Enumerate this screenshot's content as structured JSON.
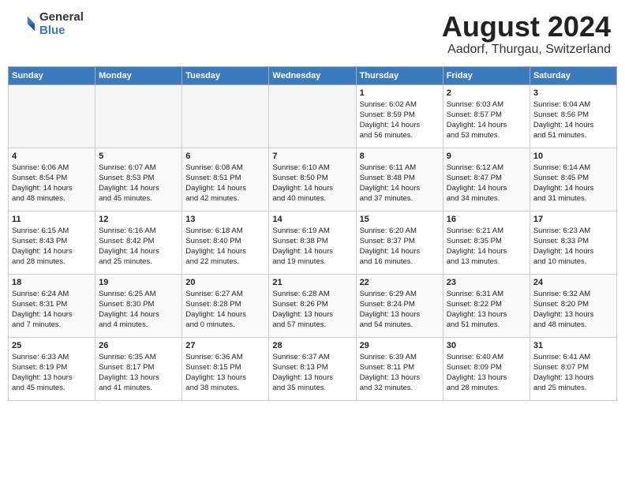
{
  "header": {
    "logo_general": "General",
    "logo_blue": "Blue",
    "month_title": "August 2024",
    "location": "Aadorf, Thurgau, Switzerland"
  },
  "days_of_week": [
    "Sunday",
    "Monday",
    "Tuesday",
    "Wednesday",
    "Thursday",
    "Friday",
    "Saturday"
  ],
  "weeks": [
    [
      {
        "day": "",
        "info": ""
      },
      {
        "day": "",
        "info": ""
      },
      {
        "day": "",
        "info": ""
      },
      {
        "day": "",
        "info": ""
      },
      {
        "day": "1",
        "info": "Sunrise: 6:02 AM\nSunset: 8:59 PM\nDaylight: 14 hours\nand 56 minutes."
      },
      {
        "day": "2",
        "info": "Sunrise: 6:03 AM\nSunset: 8:57 PM\nDaylight: 14 hours\nand 53 minutes."
      },
      {
        "day": "3",
        "info": "Sunrise: 6:04 AM\nSunset: 8:56 PM\nDaylight: 14 hours\nand 51 minutes."
      }
    ],
    [
      {
        "day": "4",
        "info": "Sunrise: 6:06 AM\nSunset: 8:54 PM\nDaylight: 14 hours\nand 48 minutes."
      },
      {
        "day": "5",
        "info": "Sunrise: 6:07 AM\nSunset: 8:53 PM\nDaylight: 14 hours\nand 45 minutes."
      },
      {
        "day": "6",
        "info": "Sunrise: 6:08 AM\nSunset: 8:51 PM\nDaylight: 14 hours\nand 42 minutes."
      },
      {
        "day": "7",
        "info": "Sunrise: 6:10 AM\nSunset: 8:50 PM\nDaylight: 14 hours\nand 40 minutes."
      },
      {
        "day": "8",
        "info": "Sunrise: 6:11 AM\nSunset: 8:48 PM\nDaylight: 14 hours\nand 37 minutes."
      },
      {
        "day": "9",
        "info": "Sunrise: 6:12 AM\nSunset: 8:47 PM\nDaylight: 14 hours\nand 34 minutes."
      },
      {
        "day": "10",
        "info": "Sunrise: 6:14 AM\nSunset: 8:45 PM\nDaylight: 14 hours\nand 31 minutes."
      }
    ],
    [
      {
        "day": "11",
        "info": "Sunrise: 6:15 AM\nSunset: 8:43 PM\nDaylight: 14 hours\nand 28 minutes."
      },
      {
        "day": "12",
        "info": "Sunrise: 6:16 AM\nSunset: 8:42 PM\nDaylight: 14 hours\nand 25 minutes."
      },
      {
        "day": "13",
        "info": "Sunrise: 6:18 AM\nSunset: 8:40 PM\nDaylight: 14 hours\nand 22 minutes."
      },
      {
        "day": "14",
        "info": "Sunrise: 6:19 AM\nSunset: 8:38 PM\nDaylight: 14 hours\nand 19 minutes."
      },
      {
        "day": "15",
        "info": "Sunrise: 6:20 AM\nSunset: 8:37 PM\nDaylight: 14 hours\nand 16 minutes."
      },
      {
        "day": "16",
        "info": "Sunrise: 6:21 AM\nSunset: 8:35 PM\nDaylight: 14 hours\nand 13 minutes."
      },
      {
        "day": "17",
        "info": "Sunrise: 6:23 AM\nSunset: 8:33 PM\nDaylight: 14 hours\nand 10 minutes."
      }
    ],
    [
      {
        "day": "18",
        "info": "Sunrise: 6:24 AM\nSunset: 8:31 PM\nDaylight: 14 hours\nand 7 minutes."
      },
      {
        "day": "19",
        "info": "Sunrise: 6:25 AM\nSunset: 8:30 PM\nDaylight: 14 hours\nand 4 minutes."
      },
      {
        "day": "20",
        "info": "Sunrise: 6:27 AM\nSunset: 8:28 PM\nDaylight: 14 hours\nand 0 minutes."
      },
      {
        "day": "21",
        "info": "Sunrise: 6:28 AM\nSunset: 8:26 PM\nDaylight: 13 hours\nand 57 minutes."
      },
      {
        "day": "22",
        "info": "Sunrise: 6:29 AM\nSunset: 8:24 PM\nDaylight: 13 hours\nand 54 minutes."
      },
      {
        "day": "23",
        "info": "Sunrise: 6:31 AM\nSunset: 8:22 PM\nDaylight: 13 hours\nand 51 minutes."
      },
      {
        "day": "24",
        "info": "Sunrise: 6:32 AM\nSunset: 8:20 PM\nDaylight: 13 hours\nand 48 minutes."
      }
    ],
    [
      {
        "day": "25",
        "info": "Sunrise: 6:33 AM\nSunset: 8:19 PM\nDaylight: 13 hours\nand 45 minutes."
      },
      {
        "day": "26",
        "info": "Sunrise: 6:35 AM\nSunset: 8:17 PM\nDaylight: 13 hours\nand 41 minutes."
      },
      {
        "day": "27",
        "info": "Sunrise: 6:36 AM\nSunset: 8:15 PM\nDaylight: 13 hours\nand 38 minutes."
      },
      {
        "day": "28",
        "info": "Sunrise: 6:37 AM\nSunset: 8:13 PM\nDaylight: 13 hours\nand 35 minutes."
      },
      {
        "day": "29",
        "info": "Sunrise: 6:39 AM\nSunset: 8:11 PM\nDaylight: 13 hours\nand 32 minutes."
      },
      {
        "day": "30",
        "info": "Sunrise: 6:40 AM\nSunset: 8:09 PM\nDaylight: 13 hours\nand 28 minutes."
      },
      {
        "day": "31",
        "info": "Sunrise: 6:41 AM\nSunset: 8:07 PM\nDaylight: 13 hours\nand 25 minutes."
      }
    ]
  ]
}
